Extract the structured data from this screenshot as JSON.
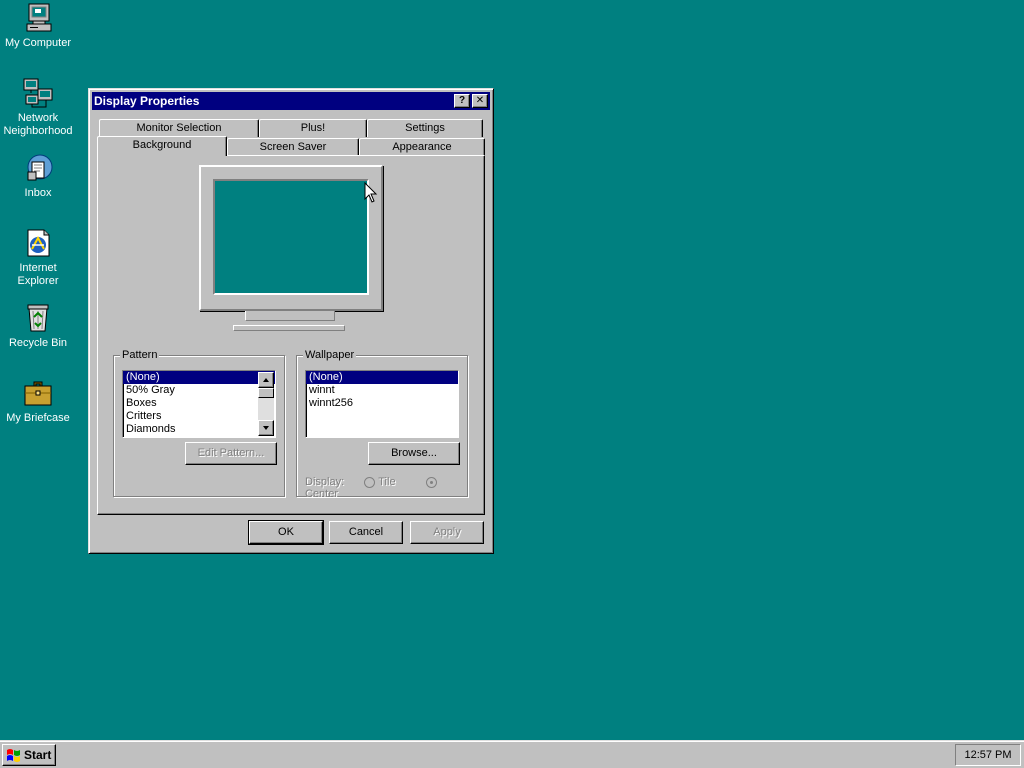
{
  "desktop": {
    "background_color": "#008080",
    "icons": [
      {
        "label": "My Computer",
        "icon": "computer-icon"
      },
      {
        "label": "Network\nNeighborhood",
        "icon": "network-icon"
      },
      {
        "label": "Inbox",
        "icon": "inbox-icon"
      },
      {
        "label": "Internet\nExplorer",
        "icon": "internet-explorer-icon"
      },
      {
        "label": "Recycle Bin",
        "icon": "recycle-bin-icon"
      },
      {
        "label": "My Briefcase",
        "icon": "briefcase-icon"
      }
    ]
  },
  "dialog": {
    "title": "Display Properties",
    "help_button": "?",
    "close_button": "✕",
    "tabs_back_row": [
      "Monitor Selection",
      "Plus!",
      "Settings"
    ],
    "tabs_front_row": [
      "Background",
      "Screen Saver",
      "Appearance"
    ],
    "active_tab": "Background",
    "pattern": {
      "label": "Pattern",
      "items": [
        "(None)",
        "50% Gray",
        "Boxes",
        "Critters",
        "Diamonds"
      ],
      "selected": "(None)",
      "edit_button": "Edit Pattern..."
    },
    "wallpaper": {
      "label": "Wallpaper",
      "items": [
        "(None)",
        "winnt",
        "winnt256"
      ],
      "selected": "(None)",
      "browse_button": "Browse...",
      "display_label": "Display:",
      "option_tile": "Tile",
      "option_center": "Center",
      "display_selected": "Center"
    },
    "buttons": {
      "ok": "OK",
      "cancel": "Cancel",
      "apply": "Apply"
    }
  },
  "taskbar": {
    "start_label": "Start",
    "clock": "12:57 PM"
  },
  "colors": {
    "desktop": "#008080",
    "titlebar": "#000080",
    "face": "#c0c0c0",
    "selection": "#000080"
  }
}
